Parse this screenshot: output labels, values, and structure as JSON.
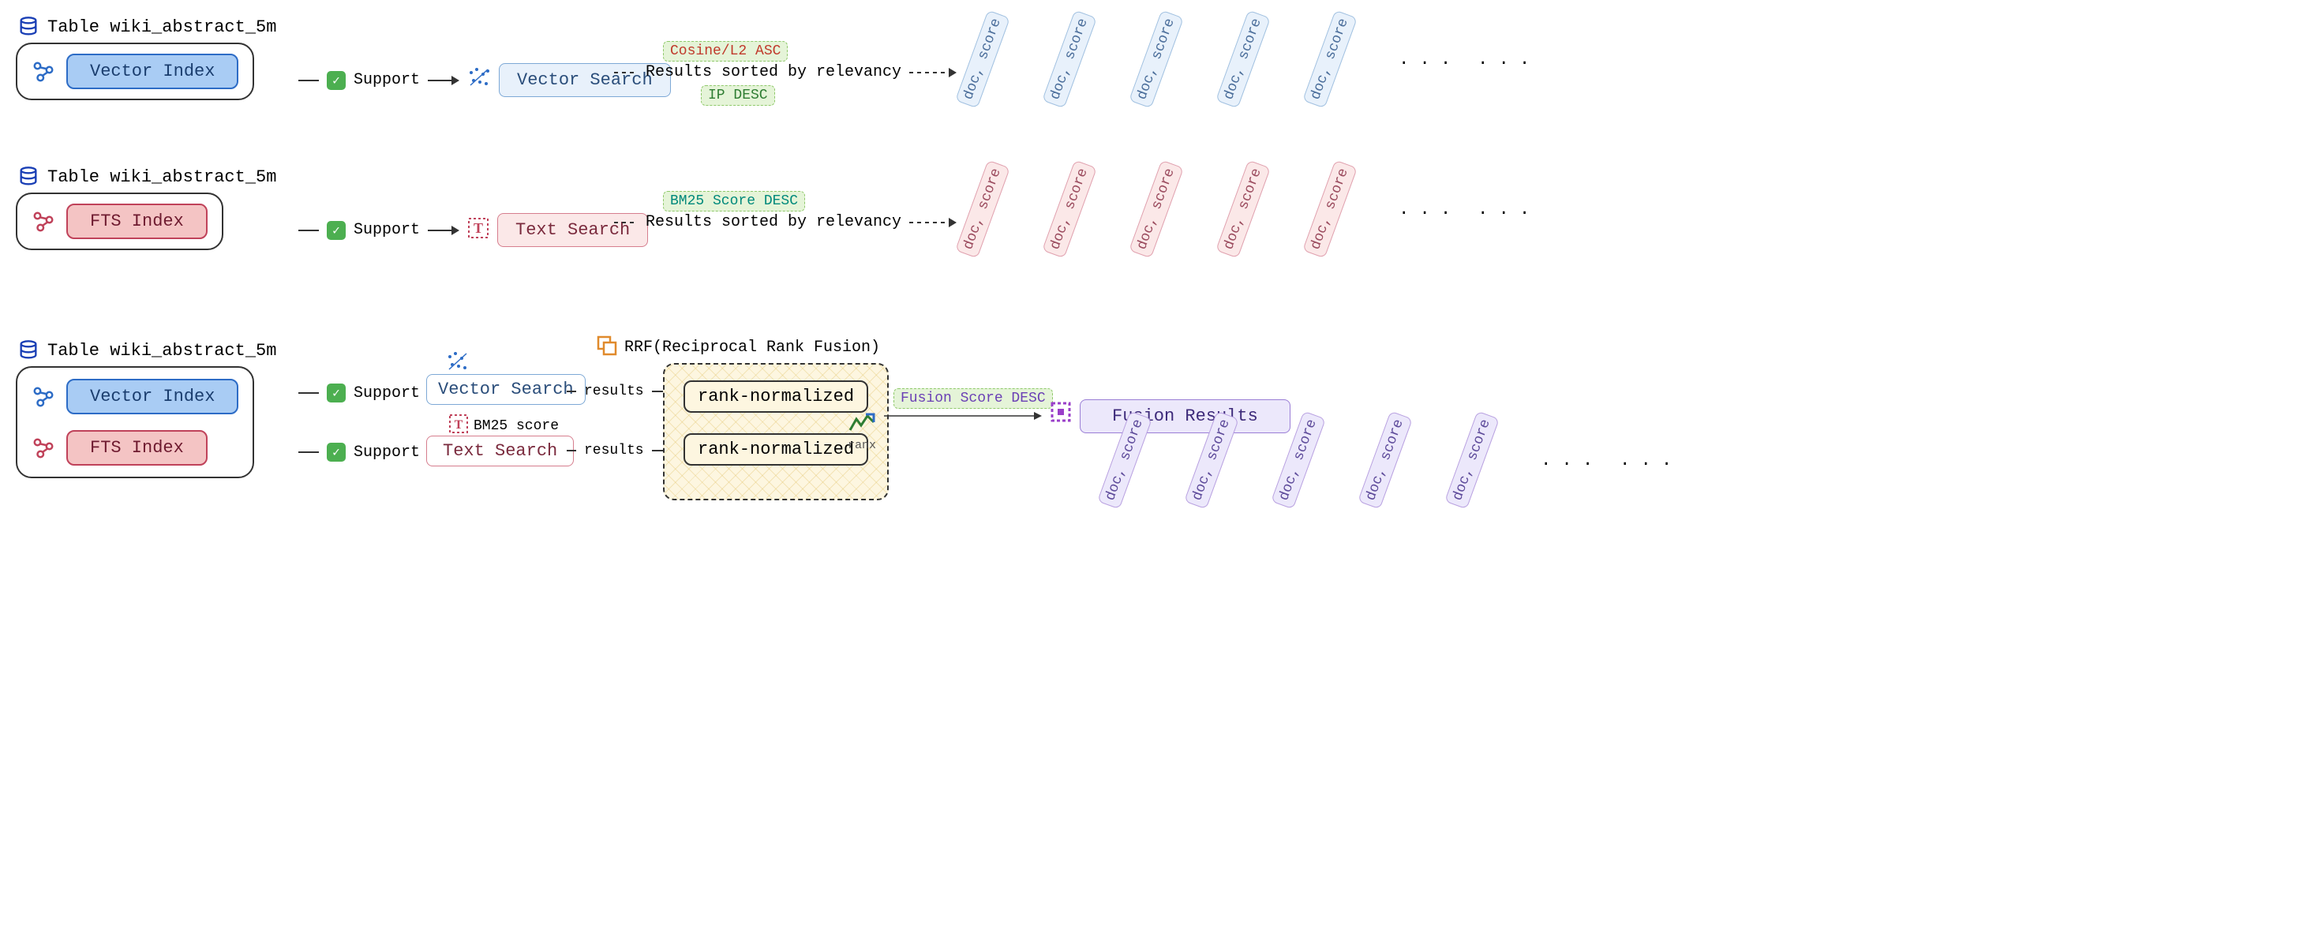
{
  "table_name": "Table wiki_abstract_5m",
  "vector_index_label": "Vector Index",
  "fts_index_label": "FTS Index",
  "support_label": "Support",
  "vector_search_label": "Vector Search",
  "text_search_label": "Text Search",
  "results_sorted": "Results sorted by relevancy",
  "cosine_tag": "Cosine/L2 ASC",
  "ip_tag": "IP DESC",
  "bm25_tag": "BM25 Score DESC",
  "bm25_score_label": "BM25 score",
  "doc_score": "doc, score",
  "dots": ". . .",
  "rrf_title": "RRF(Reciprocal Rank Fusion)",
  "results_label": "results",
  "rank_normalized": "rank-normalized",
  "ranx_label": "ranx",
  "fusion_score_tag": "Fusion Score DESC",
  "fusion_results_label": "Fusion Results"
}
